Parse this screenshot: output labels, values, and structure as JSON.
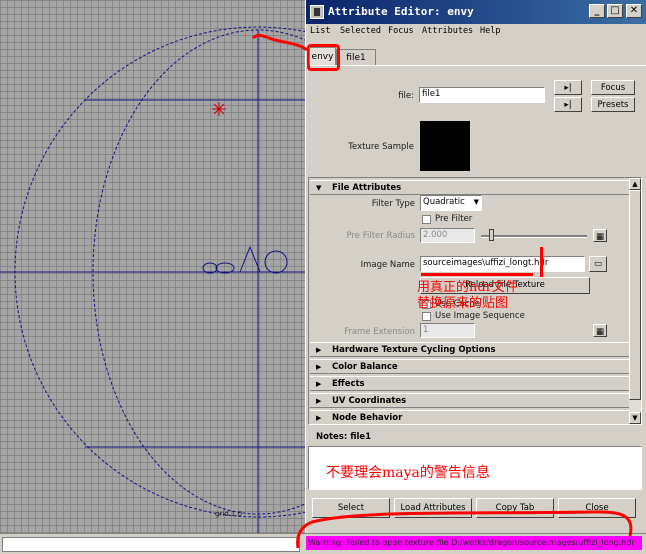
{
  "viewport": {
    "grid_label": "grid 1.0"
  },
  "window": {
    "title": "Attribute Editor: envy",
    "minimize": "_",
    "maximize": "□",
    "close": "✕"
  },
  "menu": [
    "List",
    "Selected",
    "Focus",
    "Attributes",
    "Help"
  ],
  "tabs": [
    {
      "label": "envy",
      "active": true
    },
    {
      "label": "file1",
      "active": false
    }
  ],
  "node": {
    "file_label": "file:",
    "file_value": "file1",
    "focus_button": "Focus",
    "presets_button": "Presets",
    "texture_sample_label": "Texture Sample"
  },
  "file_attributes": {
    "header": "File Attributes",
    "filter_type_label": "Filter Type",
    "filter_type_value": "Quadratic",
    "pre_filter_label": "Pre Filter",
    "pre_filter_radius_label": "Pre Filter Radius",
    "pre_filter_radius_value": "2.000",
    "image_name_label": "Image Name",
    "image_name_value": "sourceimages\\uffizi_longt.hdr",
    "reload_button": "Reload File Texture",
    "use_cache_label": "Use Cache",
    "use_image_seq_label": "Use Image Sequence",
    "frame_extension_label": "Frame Extension",
    "frame_extension_value": "1"
  },
  "sections": [
    "Hardware Texture Cycling Options",
    "Color Balance",
    "Effects",
    "UV Coordinates",
    "Node Behavior"
  ],
  "notes": {
    "label": "Notes: file1"
  },
  "bottom_buttons": [
    "Select",
    "Load Attributes",
    "Copy Tab",
    "Close"
  ],
  "help_line": "Warning: Failed to open texture file D:/works/dragon/sourceimages/uffizi_long.hdr",
  "annotations": {
    "replace_text_line1": "用真正的hdr文件",
    "replace_text_line2": "替换原来的贴图",
    "notes_text": "不要理会maya的警告信息"
  },
  "colors": {
    "title_bar": "#0a246a",
    "annotation_red": "#ff0000",
    "help_line_bg": "#ff00ff",
    "curve_blue": "#1a1a8c"
  }
}
